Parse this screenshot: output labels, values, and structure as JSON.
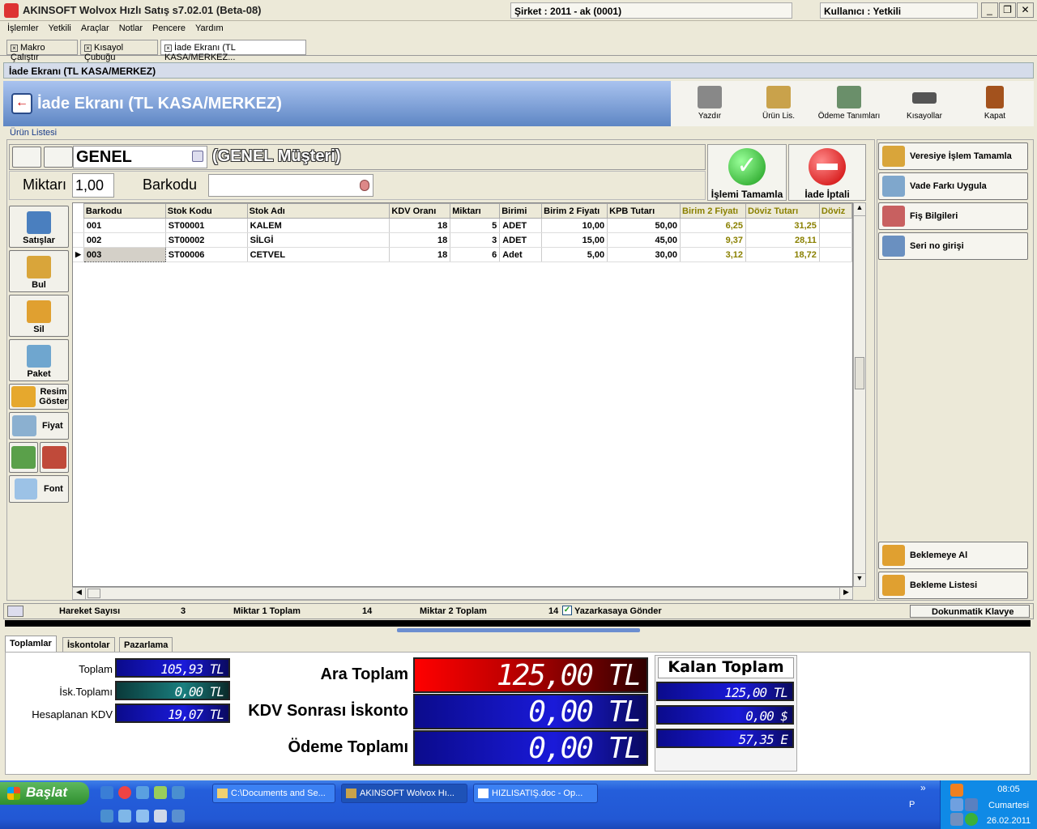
{
  "window": {
    "title": "AKINSOFT Wolvox Hızlı Satış s7.02.01 (Beta-08)",
    "company": "Şirket : 2011 - ak (0001)",
    "user": "Kullanıcı : Yetkili",
    "minimize": "_",
    "restore": "❐",
    "close": "✕"
  },
  "menu": [
    "İşlemler",
    "Yetkili",
    "Araçlar",
    "Notlar",
    "Pencere",
    "Yardım"
  ],
  "tabs": [
    "Makro Çalıştır",
    "Kısayol Çubuğu",
    "İade Ekranı (TL KASA/MERKEZ..."
  ],
  "form": {
    "caption": "İade Ekranı (TL KASA/MERKEZ)",
    "header_title": "İade Ekranı (TL KASA/MERKEZ)",
    "product_list_label": "Ürün Listesi",
    "customer_code": "GENEL",
    "customer_name": "(GENEL Müşteri)",
    "qty_label": "Miktarı",
    "qty_value": "1,00",
    "barcode_label": "Barkodu",
    "barcode_value": ""
  },
  "toolbar": {
    "print": "Yazdır",
    "product_list": "Ürün Lis.",
    "payment_defs": "Ödeme Tanımları",
    "shortcuts": "Kısayollar",
    "close": "Kapat"
  },
  "actions": {
    "complete": "İşlemi Tamamla",
    "cancel": "İade İptali"
  },
  "side_buttons": {
    "sales": "Satışlar",
    "find": "Bul",
    "delete": "Sil",
    "package": "Paket",
    "image": "Resim Göster",
    "price": "Fiyat",
    "font": "Font"
  },
  "right_buttons": {
    "credit_complete": "Veresiye İşlem Tamamla",
    "apply_term_diff": "Vade Farkı Uygula",
    "receipt_info": "Fiş Bilgileri",
    "serial_entry": "Seri no girişi",
    "hold": "Beklemeye Al",
    "hold_list": "Bekleme Listesi"
  },
  "grid": {
    "columns": [
      "Barkodu",
      "Stok Kodu",
      "Stok Adı",
      "KDV Oranı",
      "Miktarı",
      "Birimi",
      "Birim 2 Fiyatı",
      "KPB Tutarı",
      "Birim 2 Fiyatı",
      "Döviz Tutarı",
      "Döviz"
    ],
    "rows": [
      [
        "001",
        "ST00001",
        "KALEM",
        "18",
        "5",
        "ADET",
        "10,00",
        "50,00",
        "6,25",
        "31,25",
        ""
      ],
      [
        "002",
        "ST00002",
        "SİLGİ",
        "18",
        "3",
        "ADET",
        "15,00",
        "45,00",
        "9,37",
        "28,11",
        ""
      ],
      [
        "003",
        "ST00006",
        "CETVEL",
        "18",
        "6",
        "Adet",
        "5,00",
        "30,00",
        "3,12",
        "18,72",
        ""
      ]
    ]
  },
  "status": {
    "movement_label": "Hareket Sayısı",
    "movement_value": "3",
    "qty1_label": "Miktar 1 Toplam",
    "qty1_value": "14",
    "qty2_label": "Miktar 2 Toplam",
    "qty2_value": "14",
    "register_label": "Yazarkasaya Gönder",
    "register_checked": true,
    "keyboard": "Dokunmatik Klavye"
  },
  "bottom_tabs": [
    "Toplamlar",
    "İskontolar",
    "Pazarlama"
  ],
  "totals": {
    "total_label": "Toplam",
    "total_value": "105,93 TL",
    "disc_label": "İsk.Toplamı",
    "disc_value": "0,00 TL",
    "vat_label": "Hesaplanan KDV",
    "vat_value": "19,07 TL",
    "subtotal_label": "Ara Toplam",
    "subtotal_value": "125,00 TL",
    "after_vat_disc_label": "KDV Sonrası İskonto",
    "after_vat_disc_value": "0,00 TL",
    "payment_label": "Ödeme Toplamı",
    "payment_value": "0,00 TL",
    "remaining_label": "Kalan Toplam",
    "remaining_tl": "125,00 TL",
    "remaining_usd": "0,00 $",
    "remaining_eur": "57,35 E"
  },
  "taskbar": {
    "start": "Başlat",
    "tasks": [
      "C:\\Documents and Se...",
      "AKINSOFT Wolvox Hı...",
      "HIZLISATIŞ.doc - Op..."
    ],
    "chevron": "»",
    "lang": "P",
    "time": "08:05",
    "day": "Cumartesi",
    "date": "26.02.2011"
  }
}
